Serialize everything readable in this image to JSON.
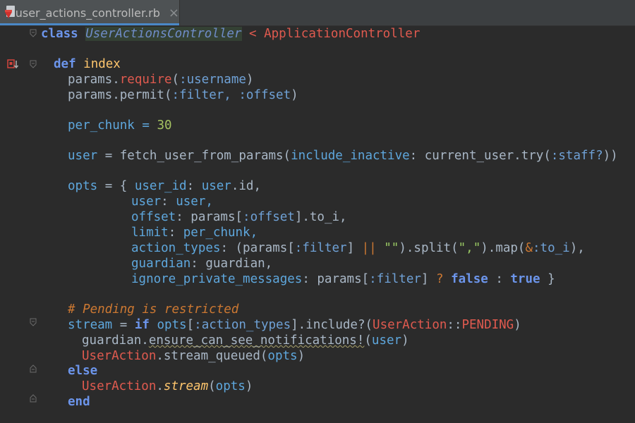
{
  "tab": {
    "filename": "user_actions_controller.rb",
    "close_glyph": "×",
    "accent": "#4a88c7"
  },
  "code": {
    "l1": [
      "class",
      " ",
      "UserActionsController",
      " < ",
      "ApplicationController"
    ],
    "l3": [
      "def",
      " ",
      "index"
    ],
    "l4": [
      "params.",
      "require",
      "(",
      ":username",
      ")"
    ],
    "l5": [
      "params.permit(",
      ":filter",
      ", ",
      ":offset",
      ")"
    ],
    "l7": [
      "per_chunk",
      " = ",
      "30"
    ],
    "l9": [
      "user",
      " = fetch_user_from_params(",
      "include_inactive",
      ": current_user.try(",
      ":staff?",
      "))"
    ],
    "l11": [
      "opts",
      " = { ",
      "user_id",
      ": ",
      "user",
      ".id,"
    ],
    "l12": [
      "user",
      ": ",
      "user",
      ","
    ],
    "l13": [
      "offset",
      ": params[",
      ":offset",
      "].to_i,"
    ],
    "l14": [
      "limit",
      ": ",
      "per_chunk",
      ","
    ],
    "l15": [
      "action_types",
      ": (params[",
      ":filter",
      "] ",
      "||",
      " ",
      "\"\"",
      ").split(",
      "\",\"",
      ").map(",
      "&",
      ":to_i",
      "),"
    ],
    "l16": [
      "guardian",
      ": guardian,"
    ],
    "l17": [
      "ignore_private_messages",
      ": params[",
      ":filter",
      "] ",
      "?",
      " ",
      "false",
      " : ",
      "true",
      " }"
    ],
    "l19": [
      "# Pending is restricted"
    ],
    "l20": [
      "stream",
      " = ",
      "if",
      " ",
      "opts",
      "[",
      ":action_types",
      "].include?(",
      "UserAction",
      "::",
      "PENDING",
      ")"
    ],
    "l21": [
      "guardian.",
      "ensure_can_see_notifications!",
      "(",
      "user",
      ")"
    ],
    "l22": [
      "UserAction",
      ".stream_queued(",
      "opts",
      ")"
    ],
    "l23": [
      "else"
    ],
    "l24": [
      "UserAction",
      ".",
      "stream",
      "(",
      "opts",
      ")"
    ],
    "l25": [
      "end"
    ]
  }
}
